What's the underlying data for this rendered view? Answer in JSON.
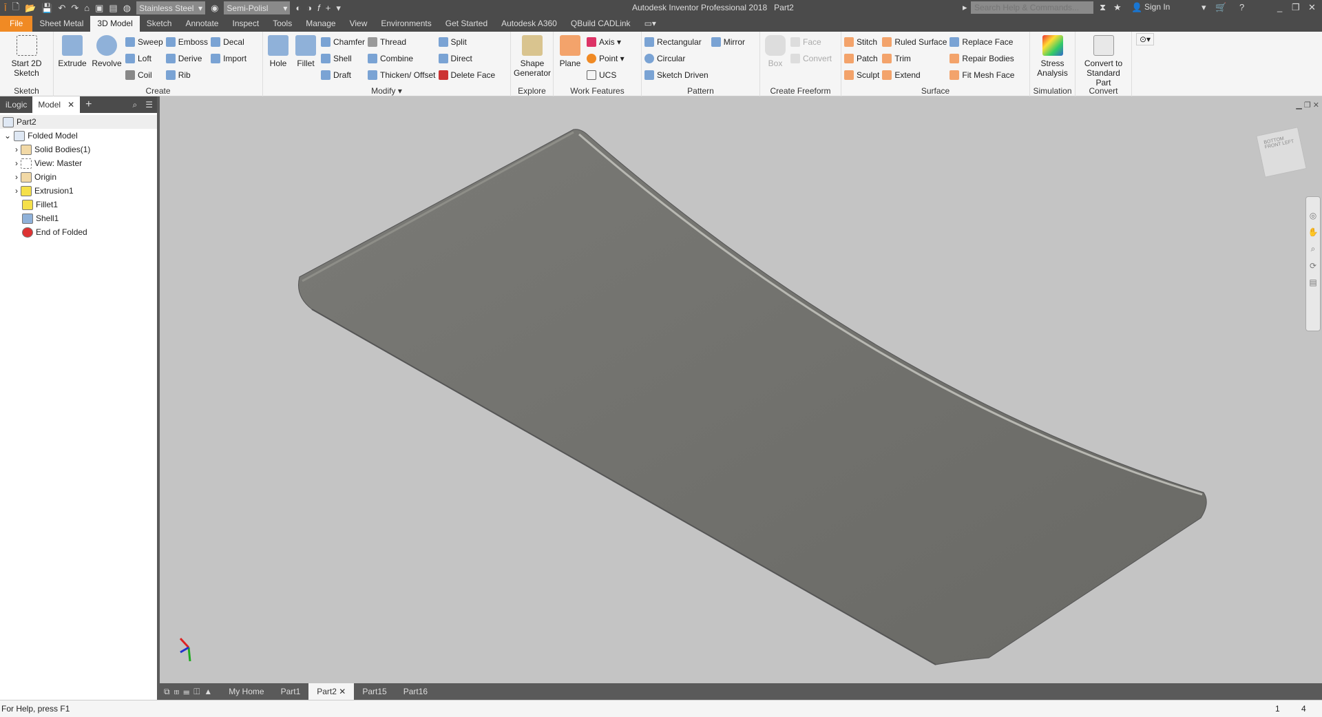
{
  "titlebar": {
    "app_title": "Autodesk Inventor Professional 2018",
    "doc_title": "Part2",
    "material": "Stainless Steel",
    "appearance": "Semi-Polisl",
    "search_placeholder": "Search Help & Commands...",
    "sign_in": "Sign In"
  },
  "tabs": [
    "File",
    "Sheet Metal",
    "3D Model",
    "Sketch",
    "Annotate",
    "Inspect",
    "Tools",
    "Manage",
    "View",
    "Environments",
    "Get Started",
    "Autodesk A360",
    "QBuild CADLink"
  ],
  "active_tab": "3D Model",
  "ribbon": {
    "sketch": {
      "label": "Sketch",
      "start": "Start 2D Sketch"
    },
    "create": {
      "label": "Create",
      "extrude": "Extrude",
      "revolve": "Revolve",
      "items": [
        "Sweep",
        "Loft",
        "Coil",
        "Emboss",
        "Derive",
        "Rib",
        "Decal",
        "Import"
      ]
    },
    "modify": {
      "label": "Modify ▾",
      "hole": "Hole",
      "fillet": "Fillet",
      "items": [
        "Chamfer",
        "Shell",
        "Draft",
        "Thread",
        "Combine",
        "Thicken/ Offset",
        "Split",
        "Direct",
        "Delete Face"
      ]
    },
    "explore": {
      "label": "Explore",
      "shape": "Shape Generator"
    },
    "work": {
      "label": "Work Features",
      "plane": "Plane",
      "items": [
        "Axis ▾",
        "Point ▾",
        "UCS"
      ]
    },
    "pattern": {
      "label": "Pattern",
      "items": [
        "Rectangular",
        "Circular",
        "Sketch Driven",
        "Mirror"
      ]
    },
    "freeform": {
      "label": "Create Freeform",
      "box": "Box",
      "items": [
        "Face",
        "Convert"
      ]
    },
    "surface": {
      "label": "Surface",
      "items": [
        "Stitch",
        "Patch",
        "Sculpt",
        "Ruled Surface",
        "Trim",
        "Extend",
        "Replace Face",
        "Repair Bodies",
        "Fit Mesh Face"
      ]
    },
    "simulation": {
      "label": "Simulation",
      "stress": "Stress Analysis"
    },
    "convert": {
      "label": "Convert",
      "std": "Convert to Standard Part"
    }
  },
  "browser": {
    "tabs": [
      "iLogic",
      "Model"
    ],
    "root": "Part2",
    "nodes": [
      "Folded Model",
      "Solid Bodies(1)",
      "View: Master",
      "Origin",
      "Extrusion1",
      "Fillet1",
      "Shell1",
      "End of Folded"
    ]
  },
  "viewcube": {
    "faces": [
      "BOTTOM",
      "FRONT",
      "LEFT"
    ]
  },
  "doc_tabs": [
    "My Home",
    "Part1",
    "Part2",
    "Part15",
    "Part16"
  ],
  "active_doc": "Part2",
  "status": {
    "help": "For Help, press F1",
    "n1": "1",
    "n2": "4"
  },
  "colors": {
    "file_tab": "#f08a24",
    "chrome": "#4b4b4b",
    "viewport": "#c4c4c4",
    "model": "#6e6e6a"
  }
}
